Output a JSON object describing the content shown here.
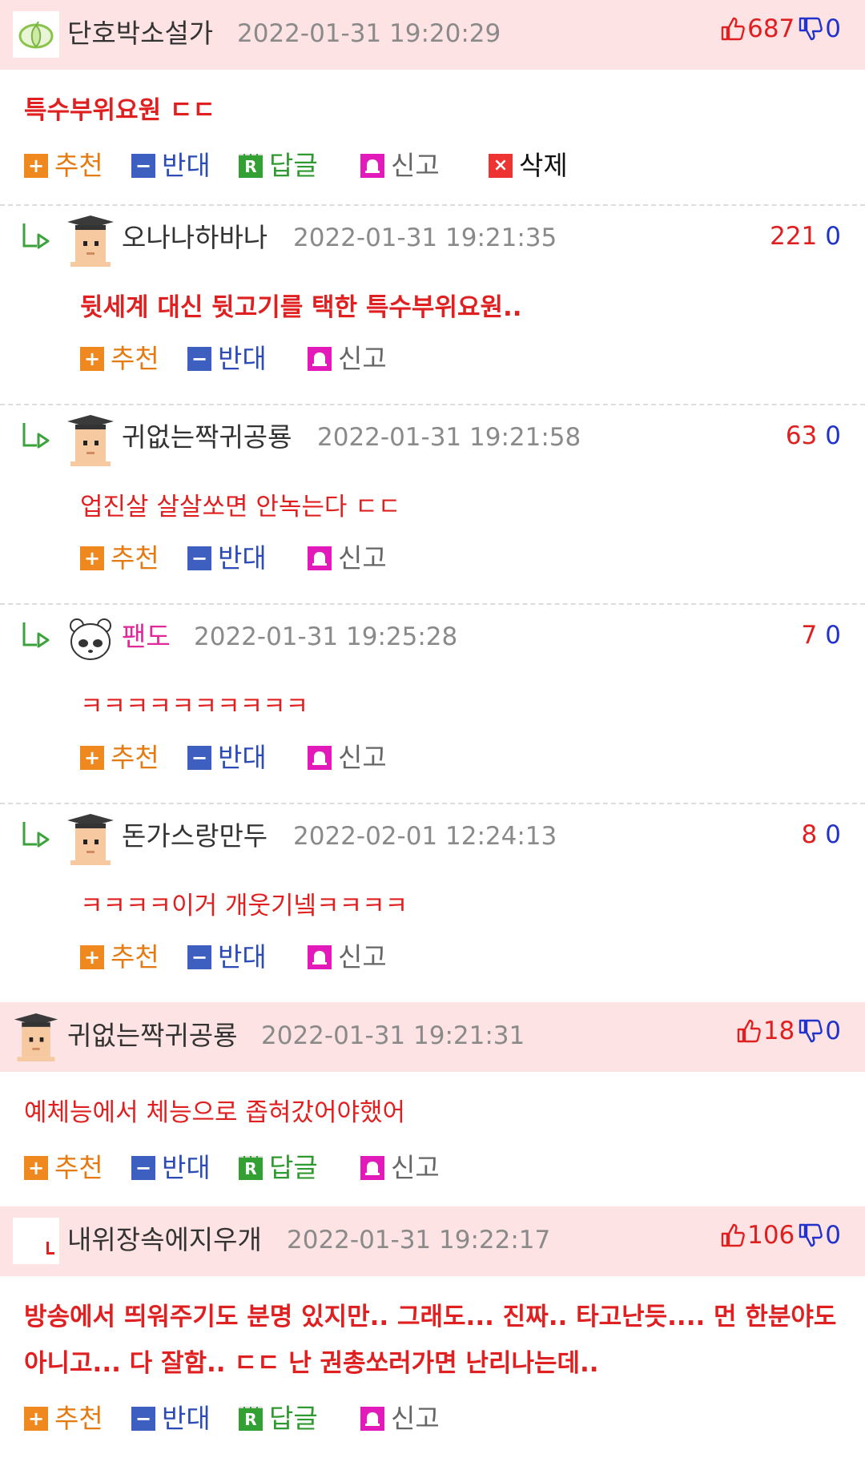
{
  "comments": [
    {
      "nick": "단호박소설가",
      "date": "2022-01-31 19:20:29",
      "up": "687",
      "down": "0",
      "text": "특수부위요원 ㄷㄷ",
      "bold": true,
      "actions": {
        "recommend": "추천",
        "oppose": "반대",
        "reply": "답글",
        "report": "신고",
        "delete": "삭제"
      },
      "replies": [
        {
          "nick": "오나나하바나",
          "date": "2022-01-31 19:21:35",
          "up": "221",
          "down": "0",
          "text": "뒷세계 대신 뒷고기를 택한 특수부위요원..",
          "bold": true,
          "actions": {
            "recommend": "추천",
            "oppose": "반대",
            "report": "신고"
          }
        },
        {
          "nick": "귀없는짝귀공룡",
          "date": "2022-01-31 19:21:58",
          "up": "63",
          "down": "0",
          "text": "업진살 살살쏘면 안녹는다 ㄷㄷ",
          "bold": false,
          "actions": {
            "recommend": "추천",
            "oppose": "반대",
            "report": "신고"
          }
        },
        {
          "nick": "팬도",
          "date": "2022-01-31 19:25:28",
          "up": "7",
          "down": "0",
          "text": "ㅋㅋㅋㅋㅋㅋㅋㅋㅋㅋ",
          "bold": false,
          "actions": {
            "recommend": "추천",
            "oppose": "반대",
            "report": "신고"
          }
        },
        {
          "nick": "돈가스랑만두",
          "date": "2022-02-01 12:24:13",
          "up": "8",
          "down": "0",
          "text": "ㅋㅋㅋㅋ이거 개웃기넼ㅋㅋㅋㅋ",
          "bold": false,
          "actions": {
            "recommend": "추천",
            "oppose": "반대",
            "report": "신고"
          }
        }
      ]
    },
    {
      "nick": "귀없는짝귀공룡",
      "date": "2022-01-31 19:21:31",
      "up": "18",
      "down": "0",
      "text": "예체능에서 체능으로 좁혀갔어야했어",
      "bold": false,
      "actions": {
        "recommend": "추천",
        "oppose": "반대",
        "reply": "답글",
        "report": "신고"
      }
    },
    {
      "nick": "내위장속에지우개",
      "date": "2022-01-31 19:22:17",
      "up": "106",
      "down": "0",
      "text": "방송에서 띄워주기도 분명 있지만.. 그래도... 진짜.. 타고난듯.... 먼 한분야도 아니고... 다 잘함.. ㄷㄷ 난 권총쏘러가면 난리나는데..",
      "bold": true,
      "actions": {
        "recommend": "추천",
        "oppose": "반대",
        "reply": "답글",
        "report": "신고"
      }
    }
  ],
  "icons": {
    "recommend": "plus-icon",
    "oppose": "minus-icon",
    "reply": "reply-r-icon",
    "report": "siren-icon",
    "delete": "x-icon",
    "up": "thumbs-up-icon",
    "down": "thumbs-down-icon"
  },
  "colors": {
    "header_bg": "#fde3e3",
    "comment_text": "#e02020",
    "down_count": "#2233cc"
  }
}
